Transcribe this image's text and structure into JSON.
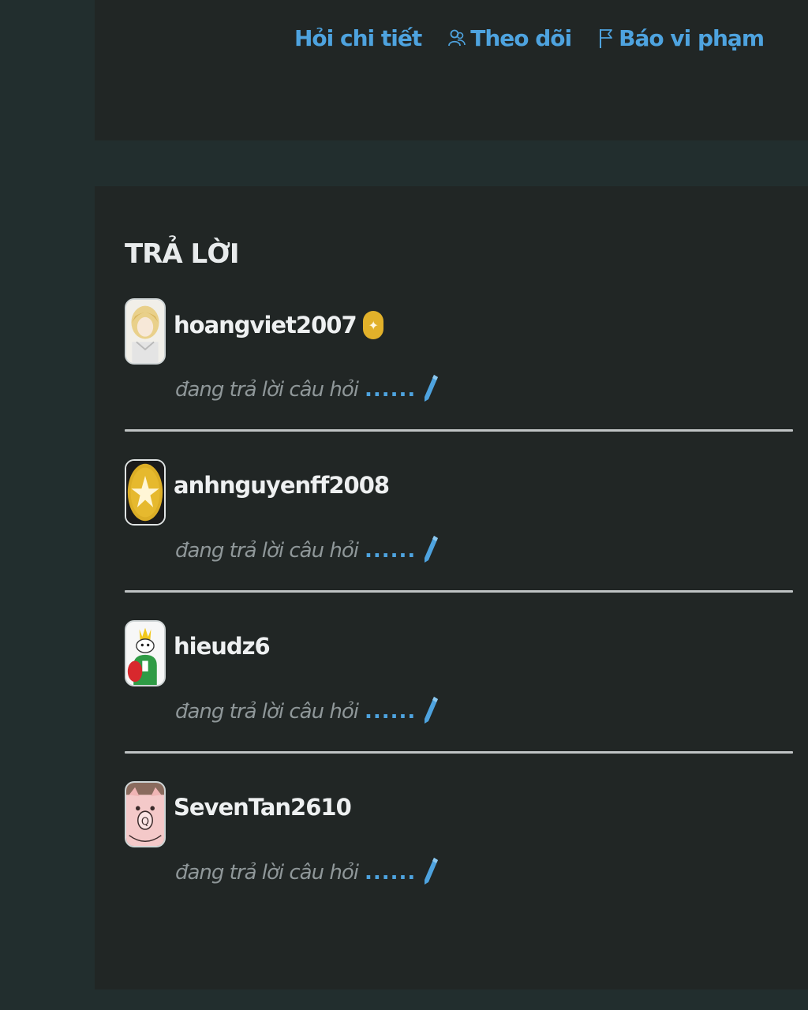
{
  "question_actions": {
    "ask_detail": "Hỏi chi tiết",
    "follow": "Theo dõi",
    "report": "Báo vi phạm"
  },
  "answers_section": {
    "title": "TRẢ LỜI",
    "status_text": "đang trả lời câu hỏi",
    "status_dots": "......",
    "items": [
      {
        "username": "hoangviet2007",
        "has_badge": true,
        "badge_glyph": "✦",
        "avatar": "anime-girl-avatar"
      },
      {
        "username": "anhnguyenff2008",
        "has_badge": false,
        "avatar": "gold-star-avatar"
      },
      {
        "username": "hieudz6",
        "has_badge": false,
        "avatar": "cartoon-king-avatar"
      },
      {
        "username": "SevenTan2610",
        "has_badge": false,
        "avatar": "pink-pig-avatar"
      }
    ]
  },
  "colors": {
    "accent": "#4ea3df",
    "background": "#222e2e",
    "card": "#212625",
    "badge": "#e2b12a"
  }
}
